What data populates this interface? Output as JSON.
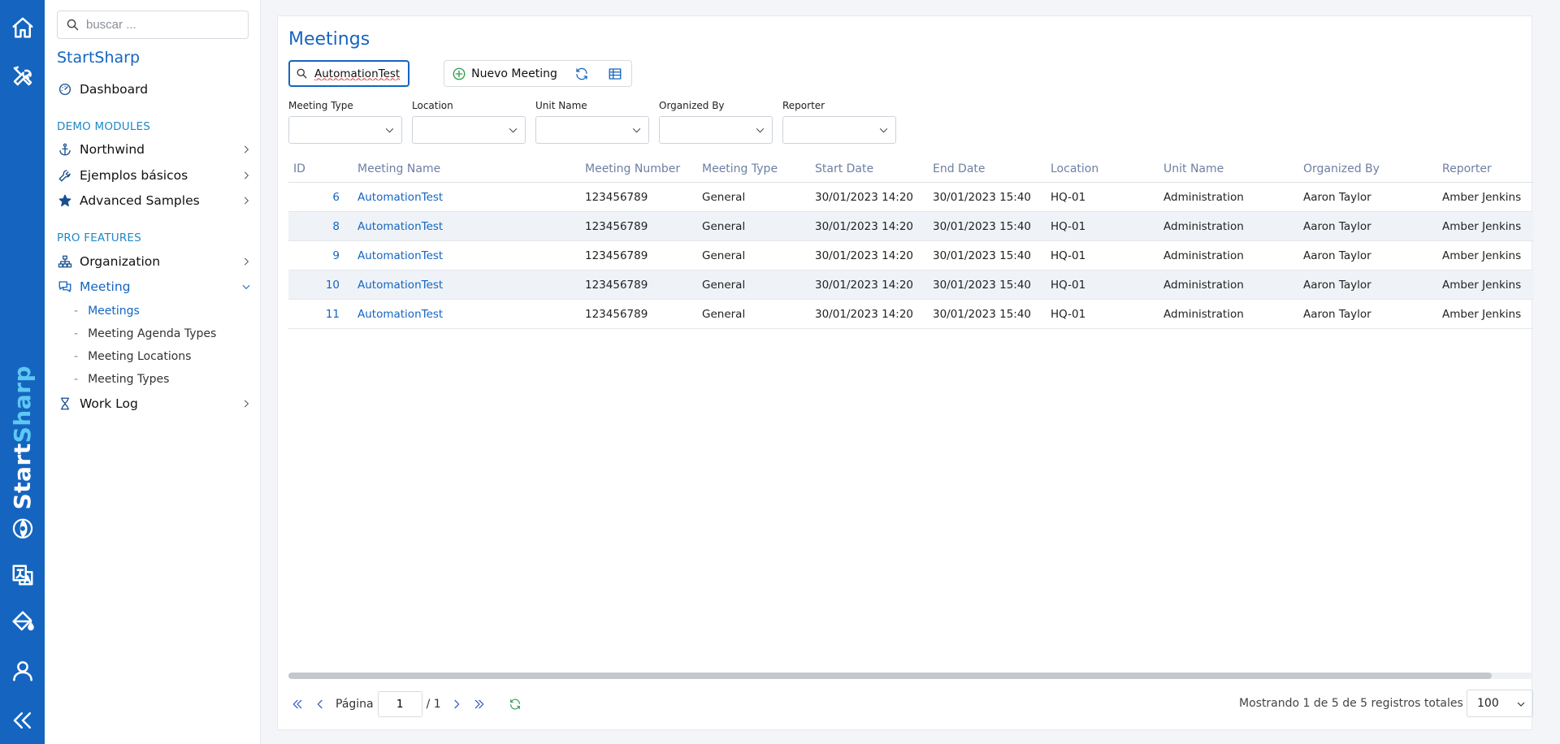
{
  "sidebar": {
    "search_placeholder": "buscar ...",
    "title": "StartSharp",
    "dashboard": "Dashboard",
    "sections": {
      "demo": "DEMO MODULES",
      "pro": "PRO FEATURES"
    },
    "items": {
      "northwind": "Northwind",
      "ejemplos": "Ejemplos básicos",
      "advanced": "Advanced Samples",
      "organization": "Organization",
      "meeting": "Meeting",
      "worklog": "Work Log"
    },
    "meeting_sub": {
      "meetings": "Meetings",
      "agenda_types": "Meeting Agenda Types",
      "locations": "Meeting Locations",
      "types": "Meeting Types"
    }
  },
  "brand": {
    "part1": "Start",
    "part2": "Sharp"
  },
  "page": {
    "title": "Meetings",
    "quick_search_value": "AutomationTest",
    "new_button": "Nuevo Meeting"
  },
  "filters": {
    "meeting_type": "Meeting Type",
    "location": "Location",
    "unit_name": "Unit Name",
    "organized_by": "Organized By",
    "reporter": "Reporter"
  },
  "grid": {
    "columns": {
      "id": "ID",
      "name": "Meeting Name",
      "number": "Meeting Number",
      "type": "Meeting Type",
      "start": "Start Date",
      "end": "End Date",
      "location": "Location",
      "unit": "Unit Name",
      "organized": "Organized By",
      "reporter": "Reporter"
    },
    "rows": [
      {
        "id": "6",
        "name": "AutomationTest",
        "number": "123456789",
        "type": "General",
        "start": "30/01/2023 14:20",
        "end": "30/01/2023 15:40",
        "location": "HQ-01",
        "unit": "Administration",
        "organized": "Aaron Taylor",
        "reporter": "Amber Jenkins"
      },
      {
        "id": "8",
        "name": "AutomationTest",
        "number": "123456789",
        "type": "General",
        "start": "30/01/2023 14:20",
        "end": "30/01/2023 15:40",
        "location": "HQ-01",
        "unit": "Administration",
        "organized": "Aaron Taylor",
        "reporter": "Amber Jenkins"
      },
      {
        "id": "9",
        "name": "AutomationTest",
        "number": "123456789",
        "type": "General",
        "start": "30/01/2023 14:20",
        "end": "30/01/2023 15:40",
        "location": "HQ-01",
        "unit": "Administration",
        "organized": "Aaron Taylor",
        "reporter": "Amber Jenkins"
      },
      {
        "id": "10",
        "name": "AutomationTest",
        "number": "123456789",
        "type": "General",
        "start": "30/01/2023 14:20",
        "end": "30/01/2023 15:40",
        "location": "HQ-01",
        "unit": "Administration",
        "organized": "Aaron Taylor",
        "reporter": "Amber Jenkins"
      },
      {
        "id": "11",
        "name": "AutomationTest",
        "number": "123456789",
        "type": "General",
        "start": "30/01/2023 14:20",
        "end": "30/01/2023 15:40",
        "location": "HQ-01",
        "unit": "Administration",
        "organized": "Aaron Taylor",
        "reporter": "Amber Jenkins"
      }
    ]
  },
  "pager": {
    "page_label": "Página",
    "page_value": "1",
    "total": "/ 1",
    "info": "Mostrando 1 de 5 de 5 registros totales",
    "page_size": "100"
  },
  "colors": {
    "accent": "#1565c0",
    "rail": "#1565c0",
    "brand_secondary": "#5ec8f2",
    "add_icon": "#2e9e4a"
  },
  "icons": {
    "rail": [
      "home-icon",
      "tools-icon",
      "translate-icon",
      "paint-bucket-icon",
      "user-icon",
      "collapse-icon"
    ]
  }
}
